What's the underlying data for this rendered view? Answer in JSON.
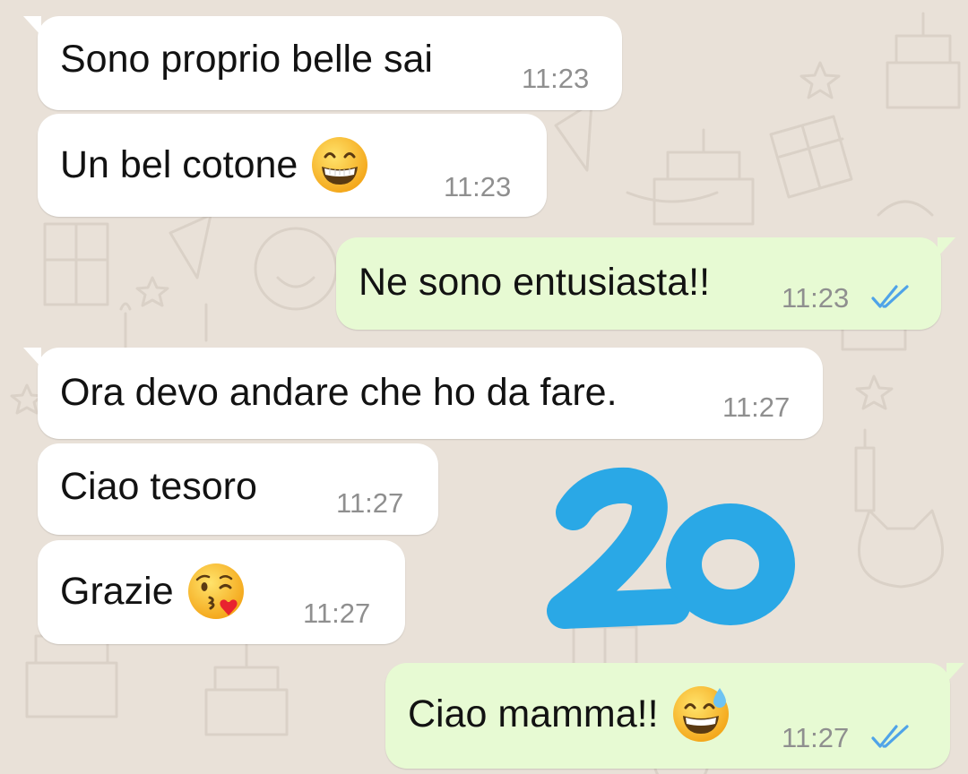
{
  "chat": {
    "messages": [
      {
        "direction": "incoming",
        "text": "Sono proprio belle sai",
        "time": "11:23"
      },
      {
        "direction": "incoming",
        "text": "Un bel cotone",
        "time": "11:23",
        "emoji": "grinning-face-with-smiling-eyes"
      },
      {
        "direction": "outgoing",
        "text": "Ne sono entusiasta!!",
        "time": "11:23",
        "status": "read-double-check"
      },
      {
        "direction": "incoming",
        "text": "Ora devo andare che ho da fare.",
        "time": "11:27"
      },
      {
        "direction": "incoming",
        "text": "Ciao tesoro",
        "time": "11:27"
      },
      {
        "direction": "incoming",
        "text": "Grazie",
        "time": "11:27",
        "emoji": "face-blowing-a-kiss"
      },
      {
        "direction": "outgoing",
        "text": "Ciao mamma!!",
        "time": "11:27",
        "emoji": "grinning-face-with-sweat",
        "status": "read-double-check"
      }
    ]
  },
  "overlay": {
    "text": "20",
    "color": "#2aa8e6"
  },
  "colors": {
    "background": "#e9e1d8",
    "incoming_bubble": "#ffffff",
    "outgoing_bubble": "#e7fad3",
    "read_ticks": "#4fa3e8",
    "timestamp": "#8f8f8f"
  }
}
